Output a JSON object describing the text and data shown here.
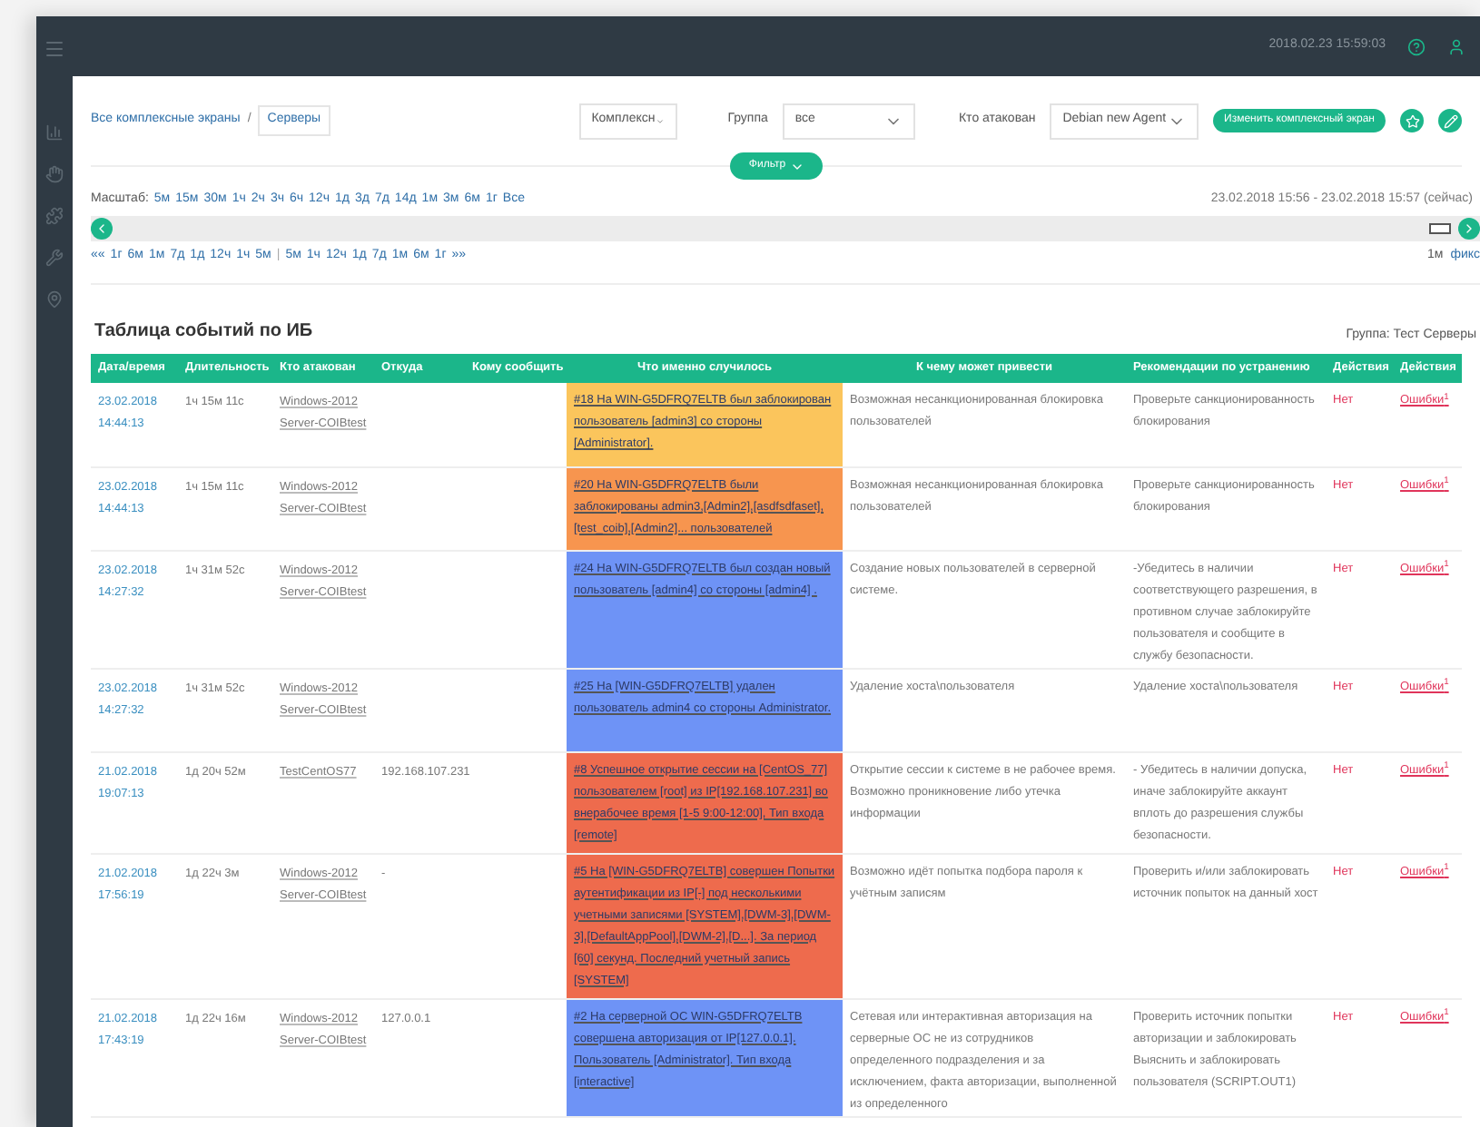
{
  "top_bar": {
    "datetime": "2018.02.23 15:59:03"
  },
  "filters": {
    "breadcrumb": [
      {
        "label": "Все комплексные экраны",
        "selected": false
      },
      {
        "label": "Серверы",
        "selected": true
      }
    ],
    "separator": "/",
    "complex_select": "Комплексн",
    "group_label": "Группа",
    "group_select": "все",
    "attacked_label": "Кто атакован",
    "attacked_select": "Debian new Agent",
    "edit_button": "Изменить комплексный экран",
    "filter_button": "Фильтр"
  },
  "timeline": {
    "scale_label": "Масштаб:",
    "scales": [
      "5м",
      "15м",
      "30м",
      "1ч",
      "2ч",
      "3ч",
      "6ч",
      "12ч",
      "1д",
      "3д",
      "7д",
      "14д",
      "1м",
      "3м",
      "6м",
      "1г",
      "Все"
    ],
    "range": "23.02.2018 15:56 - 23.02.2018 15:57 (сейчас)",
    "back": [
      "««",
      "1г",
      "6м",
      "1м",
      "7д",
      "1д",
      "12ч",
      "1ч",
      "5м"
    ],
    "divider": "|",
    "forward": [
      "5м",
      "1ч",
      "12ч",
      "1д",
      "7д",
      "1м",
      "6м",
      "1г",
      "»»"
    ],
    "right_label": "1м",
    "fix_label": "фикс"
  },
  "table": {
    "title": "Таблица событий по ИБ",
    "group_note": "Группа: Тест Серверы",
    "columns": [
      "Дата/время",
      "Длительность",
      "Кто атакован",
      "Откуда",
      "Кому сообщить",
      "Что именно случилось",
      "К чему может привести",
      "Рекомендации по устранению",
      "Действия",
      "Действия"
    ],
    "rows": [
      {
        "date": "23.02.2018",
        "time": "14:44:13",
        "duration": "1ч 15м 11с",
        "target": "Windows-2012 Server-COIBtest",
        "source": "",
        "what": "#18 На WIN-G5DFRQ7ELTB был заблокирован пользователь [admin3] со стороны [Administrator].",
        "color": "#fbc55c",
        "result": "Возможная несанкционированная блокировка пользователей",
        "recommendation": "Проверьте санкционированность блокирования",
        "action": "Нет",
        "errors": "Ошибки$^{1}$"
      },
      {
        "date": "23.02.2018",
        "time": "14:44:13",
        "duration": "1ч 15м 11с",
        "target": "Windows-2012 Server-COIBtest",
        "source": "",
        "what": "#20 На WIN-G5DFRQ7ELTB были заблокированы admin3,[Admin2],[asdfsdfaset],[test_coib],[Admin2]... пользователей",
        "color": "#f7954f",
        "result": "Возможная несанкционированная блокировка пользователей",
        "recommendation": "Проверьте санкционированность блокирования",
        "action": "Нет",
        "errors": "Ошибки$^{1}$"
      },
      {
        "date": "23.02.2018",
        "time": "14:27:32",
        "duration": "1ч 31м 52с",
        "target": "Windows-2012 Server-COIBtest",
        "source": "",
        "what": "#24 На WIN-G5DFRQ7ELTB был создан новый пользователь [admin4] со стороны [admin4] .",
        "color": "#6e93f6",
        "result": "Создание новых пользователей в серверной системе.",
        "recommendation": "-Убедитесь в наличии соответствующего разрешения, в противном случае заблокируйте пользователя и сообщите в службу безопасности.",
        "action": "Нет",
        "errors": "Ошибки$^{1}$"
      },
      {
        "date": "23.02.2018",
        "time": "14:27:32",
        "duration": "1ч 31м 52с",
        "target": "Windows-2012 Server-COIBtest",
        "source": "",
        "what": "#25 На [WIN-G5DFRQ7ELTB] удален пользователь admin4 со стороны Administrator.",
        "color": "#6e93f6",
        "result": "Удаление хоста\\пользователя",
        "recommendation": "Удаление хоста\\пользователя",
        "action": "Нет",
        "errors": "Ошибки$^{1}$"
      },
      {
        "date": "21.02.2018",
        "time": "19:07:13",
        "duration": "1д 20ч 52м",
        "target": "TestCentOS77",
        "source": "192.168.107.231",
        "what": "#8 Успешное открытие сессии на [CentOS_77] пользователем [root] из IP[192.168.107.231] во внерабочее время [1-5 9:00-12:00], Тип входа [remote]",
        "color": "#ee6b4d",
        "result": "Открытие сессии к системе в не рабочее время. Возможно проникновение либо утечка информации",
        "recommendation": "- Убедитесь в наличии допуска, иначе заблокируйте аккаунт вплоть до разрешения службы безопасности.",
        "action": "Нет",
        "errors": "Ошибки$^{1}$"
      },
      {
        "date": "21.02.2018",
        "time": "17:56:19",
        "duration": "1д 22ч 3м",
        "target": "Windows-2012 Server-COIBtest",
        "source": "-",
        "what": "#5 На [WIN-G5DFRQ7ELTB] совершен Попытки аутентификации из IP[-] под несколькими учетными записями [SYSTEM],[DWM-3],[DWM-3],[DefaultAppPool],[DWM-2],[D...]. За период [60] секунд. Последний учетный запись [SYSTEM]",
        "color": "#ee6b4d",
        "result": "Возможно идёт попытка подбора пароля к учётным записям",
        "recommendation": "Проверить и/или заблокировать источник попыток на данный хост",
        "action": "Нет",
        "errors": "Ошибки$^{1}$"
      },
      {
        "date": "21.02.2018",
        "time": "17:43:19",
        "duration": "1д 22ч 16м",
        "target": "Windows-2012 Server-COIBtest",
        "source": "127.0.0.1",
        "what": "#2 На серверной ОС WIN-G5DFRQ7ELTB совершена авторизация от IP[127.0.0.1]. Пользователь [Administrator]. Тип входа [interactive]",
        "color": "#6e93f6",
        "result": "Сетевая или интерактивная авторизация на серверные ОС не из сотрудников определенного подразделения и за исключением, факта авторизации, выполненной из определенного",
        "recommendation": "Проверить источник попытки авторизации и заблокировать Выяснить и заблокировать пользователя (SCRIPT.OUT1)",
        "action": "Нет",
        "errors": "Ошибки$^{1}$"
      }
    ]
  }
}
